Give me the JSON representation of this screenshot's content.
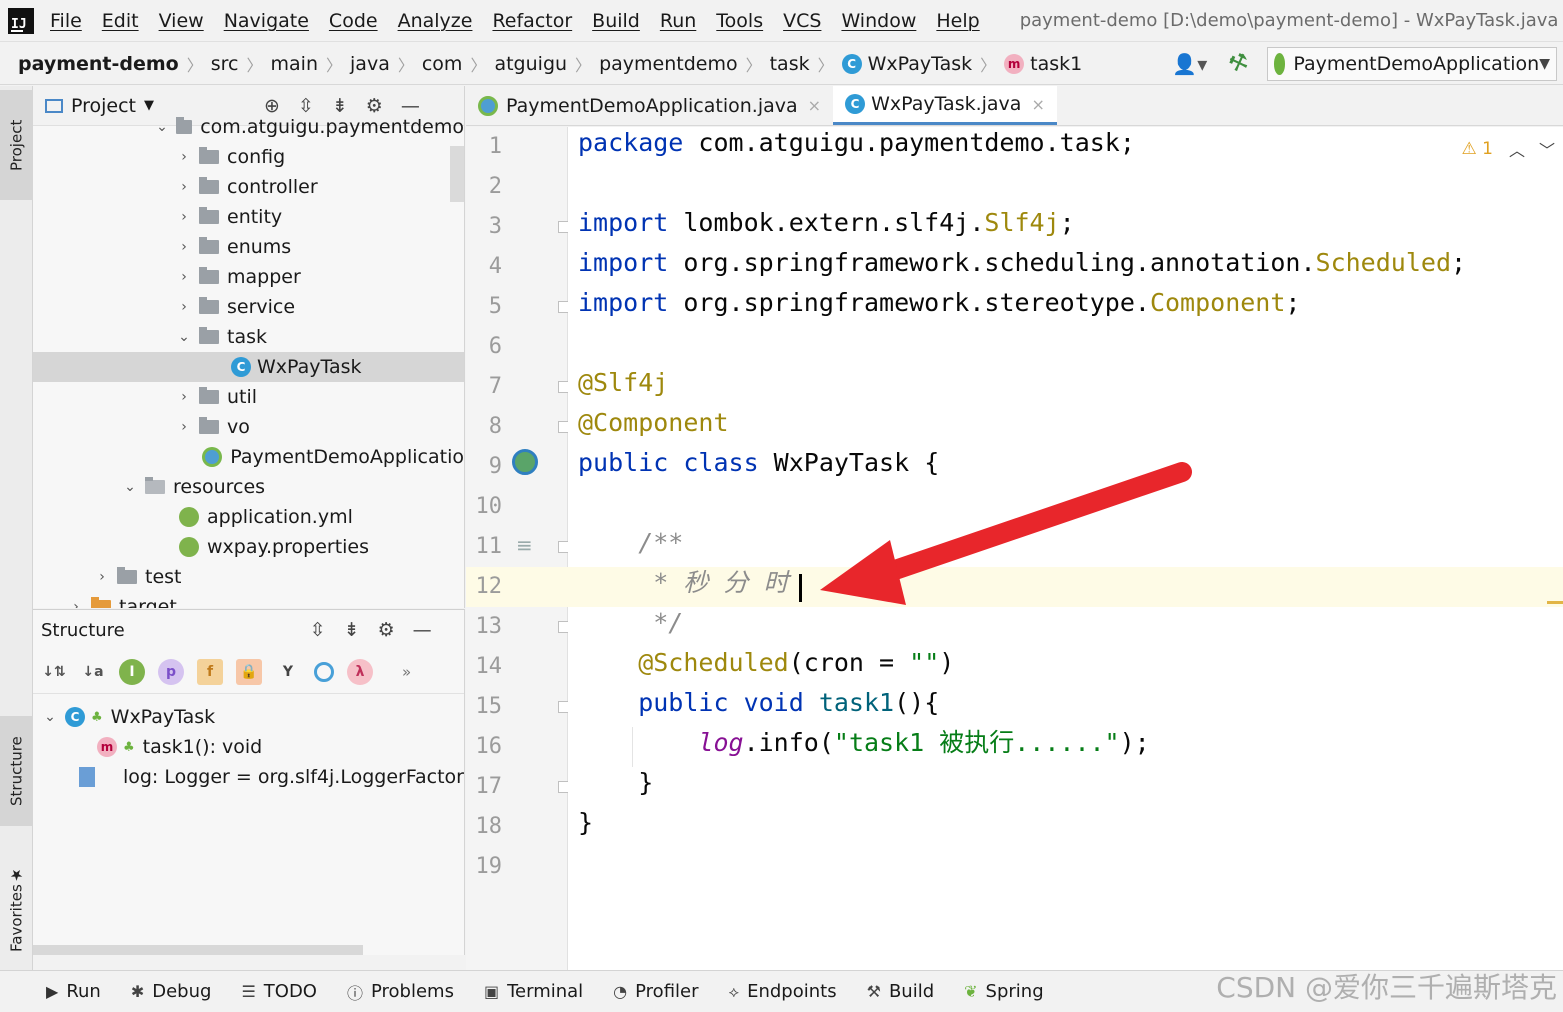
{
  "menubar": {
    "items": [
      "File",
      "Edit",
      "View",
      "Navigate",
      "Code",
      "Analyze",
      "Refactor",
      "Build",
      "Run",
      "Tools",
      "VCS",
      "Window",
      "Help"
    ],
    "window_title": "payment-demo [D:\\demo\\payment-demo] - WxPayTask.java"
  },
  "navbar": {
    "crumbs": [
      "payment-demo",
      "src",
      "main",
      "java",
      "com",
      "atguigu",
      "paymentdemo",
      "task",
      "WxPayTask",
      "task1"
    ],
    "run_config": "PaymentDemoApplication"
  },
  "left_strip": {
    "project": "Project",
    "structure": "Structure",
    "favorites": "Favorites"
  },
  "project_panel": {
    "title": "Project",
    "rows": [
      {
        "label": "com.atguigu.paymentdemo",
        "indent": 150
      },
      {
        "label": "config",
        "indent": 178
      },
      {
        "label": "controller",
        "indent": 178
      },
      {
        "label": "entity",
        "indent": 178
      },
      {
        "label": "enums",
        "indent": 178
      },
      {
        "label": "mapper",
        "indent": 178
      },
      {
        "label": "service",
        "indent": 178
      },
      {
        "label": "task",
        "indent": 178
      },
      {
        "label": "WxPayTask",
        "indent": 232
      },
      {
        "label": "util",
        "indent": 178
      },
      {
        "label": "vo",
        "indent": 178
      },
      {
        "label": "PaymentDemoApplicatio",
        "indent": 200
      },
      {
        "label": "resources",
        "indent": 124
      },
      {
        "label": "application.yml",
        "indent": 174
      },
      {
        "label": "wxpay.properties",
        "indent": 174
      },
      {
        "label": "test",
        "indent": 96
      },
      {
        "label": "target",
        "indent": 70
      }
    ]
  },
  "structure_panel": {
    "title": "Structure",
    "class_name": "WxPayTask",
    "members": [
      "task1(): void",
      "log: Logger = org.slf4j.LoggerFactor"
    ]
  },
  "editor_tabs": [
    "PaymentDemoApplication.java",
    "WxPayTask.java"
  ],
  "editor": {
    "line_numbers": [
      "1",
      "2",
      "3",
      "4",
      "5",
      "6",
      "7",
      "8",
      "9",
      "10",
      "11",
      "12",
      "13",
      "14",
      "15",
      "16",
      "17",
      "18",
      "19"
    ],
    "warning_count": "1",
    "lines": {
      "l1_kw": "package",
      "l1_rest": " com.atguigu.paymentdemo.task;",
      "l3_kw": "import",
      "l3_pkg": " lombok.extern.slf4j.",
      "l3_cls": "Slf4j",
      "l3_end": ";",
      "l4_kw": "import",
      "l4_pkg": " org.springframework.scheduling.annotation.",
      "l4_cls": "Scheduled",
      "l4_end": ";",
      "l5_kw": "import",
      "l5_pkg": " org.springframework.stereotype.",
      "l5_cls": "Component",
      "l5_end": ";",
      "l7": "@Slf4j",
      "l8": "@Component",
      "l9_kw": "public class",
      "l9_rest": " WxPayTask {",
      "l11": "    /**",
      "l12": "     * 秒 分 时",
      "l13": "     */",
      "l14_ann": "    @Scheduled",
      "l14_rest": "(cron = ",
      "l14_str": "\"\"",
      "l14_end": ")",
      "l15_kw": "    public void",
      "l15_fn": " task1",
      "l15_end": "(){",
      "l16_log": "        log",
      "l16_mid": ".info(",
      "l16_str": "\"task1 被执行......\"",
      "l16_end": ");",
      "l17": "    }",
      "l18": "}"
    }
  },
  "bottom_bar": [
    "Run",
    "Debug",
    "TODO",
    "Problems",
    "Terminal",
    "Profiler",
    "Endpoints",
    "Build",
    "Spring"
  ],
  "watermark": "CSDN @爱你三千遍斯塔克",
  "colors": {
    "keyword": "#0033b3",
    "annotation": "#9e880d",
    "string": "#067d17",
    "comment": "#8c8c8c",
    "arrow": "#e8262b"
  }
}
